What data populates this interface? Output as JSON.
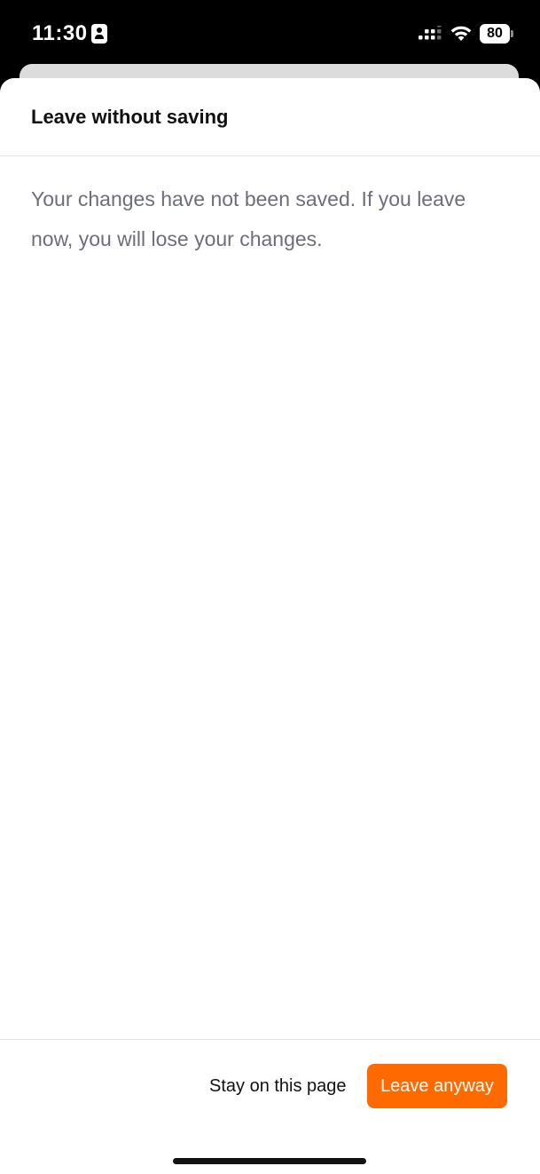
{
  "status_bar": {
    "time": "11:30",
    "battery_level": "80",
    "icons": [
      "contact-card-icon",
      "signal-icon",
      "wifi-icon",
      "battery-icon"
    ]
  },
  "dialog": {
    "title": "Leave without saving",
    "message": "Your changes have not been saved. If you leave now, you will lose your changes.",
    "secondary_button_label": "Stay on this page",
    "primary_button_label": "Leave anyway"
  },
  "colors": {
    "primary_button": "#ff6a00",
    "message_text": "#6c6f78",
    "title_text": "#111111"
  }
}
